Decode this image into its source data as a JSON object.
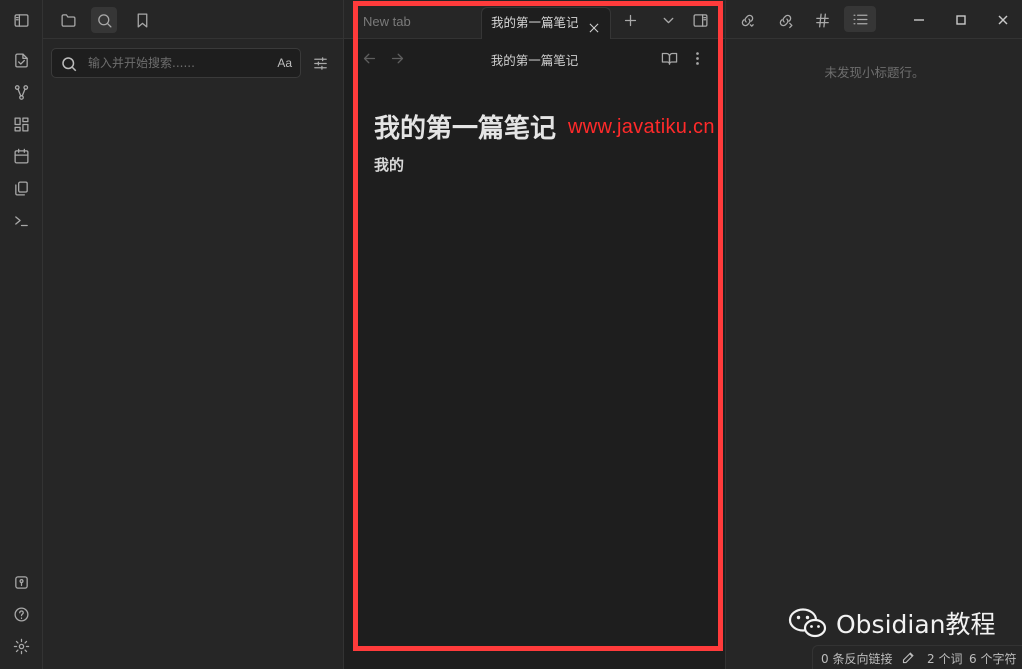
{
  "ribbon": {
    "top_icons": [
      "sidebar-toggle-icon"
    ],
    "icons": [
      "new-note-icon",
      "graph-icon",
      "canvas-icon",
      "calendar-icon",
      "templates-icon",
      "terminal-icon"
    ],
    "bottom_icons": [
      "vault-icon",
      "help-icon",
      "settings-icon"
    ]
  },
  "left_panel": {
    "tabs": [
      "folder-icon",
      "search-icon",
      "bookmark-icon"
    ],
    "search": {
      "placeholder": "输入并开始搜索......",
      "value": "",
      "match_case_label": "Aa"
    }
  },
  "tabs": [
    {
      "label": "New tab",
      "active": false
    },
    {
      "label": "我的第一篇笔记",
      "active": true
    }
  ],
  "view": {
    "title": "我的第一篇笔记",
    "note_heading": "我的第一篇笔记",
    "note_body": "我的"
  },
  "watermark": "www.javatiku.cn",
  "right_panel": {
    "outline_empty": "未发现小标题行。"
  },
  "status": {
    "backlinks": "0 条反向链接",
    "words": "2 个词",
    "chars": "6 个字符"
  },
  "brand": "Obsidian教程",
  "colors": {
    "highlight": "#ff3b3b",
    "watermark": "#ff2a2a",
    "background": "#1e1e1e"
  }
}
